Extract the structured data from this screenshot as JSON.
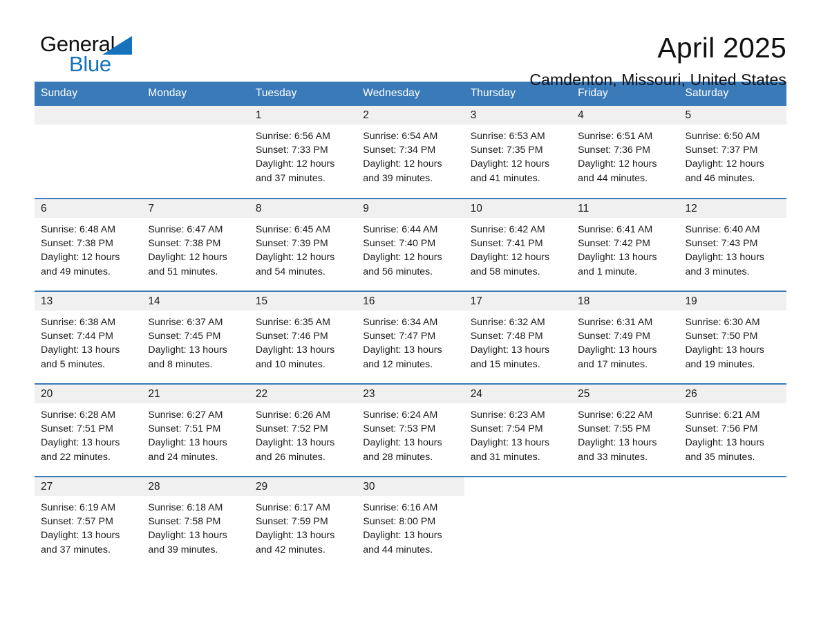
{
  "brand": {
    "word_one": "General",
    "word_two": "Blue",
    "triangle_color": "#1572bb",
    "icon": "triangle-logo-icon"
  },
  "header": {
    "title": "April 2025",
    "subtitle": "Camdenton, Missouri, United States"
  },
  "theme": {
    "header_blue": "#3a7ab8",
    "daynum_band": "#f0f0f0",
    "text": "#1a1a1a"
  },
  "calendar": {
    "weekday_headers": [
      "Sunday",
      "Monday",
      "Tuesday",
      "Wednesday",
      "Thursday",
      "Friday",
      "Saturday"
    ],
    "weeks": [
      [
        {
          "day": "",
          "lines": []
        },
        {
          "day": "",
          "lines": []
        },
        {
          "day": "1",
          "lines": [
            "Sunrise: 6:56 AM",
            "Sunset: 7:33 PM",
            "Daylight: 12 hours",
            "and 37 minutes."
          ]
        },
        {
          "day": "2",
          "lines": [
            "Sunrise: 6:54 AM",
            "Sunset: 7:34 PM",
            "Daylight: 12 hours",
            "and 39 minutes."
          ]
        },
        {
          "day": "3",
          "lines": [
            "Sunrise: 6:53 AM",
            "Sunset: 7:35 PM",
            "Daylight: 12 hours",
            "and 41 minutes."
          ]
        },
        {
          "day": "4",
          "lines": [
            "Sunrise: 6:51 AM",
            "Sunset: 7:36 PM",
            "Daylight: 12 hours",
            "and 44 minutes."
          ]
        },
        {
          "day": "5",
          "lines": [
            "Sunrise: 6:50 AM",
            "Sunset: 7:37 PM",
            "Daylight: 12 hours",
            "and 46 minutes."
          ]
        }
      ],
      [
        {
          "day": "6",
          "lines": [
            "Sunrise: 6:48 AM",
            "Sunset: 7:38 PM",
            "Daylight: 12 hours",
            "and 49 minutes."
          ]
        },
        {
          "day": "7",
          "lines": [
            "Sunrise: 6:47 AM",
            "Sunset: 7:38 PM",
            "Daylight: 12 hours",
            "and 51 minutes."
          ]
        },
        {
          "day": "8",
          "lines": [
            "Sunrise: 6:45 AM",
            "Sunset: 7:39 PM",
            "Daylight: 12 hours",
            "and 54 minutes."
          ]
        },
        {
          "day": "9",
          "lines": [
            "Sunrise: 6:44 AM",
            "Sunset: 7:40 PM",
            "Daylight: 12 hours",
            "and 56 minutes."
          ]
        },
        {
          "day": "10",
          "lines": [
            "Sunrise: 6:42 AM",
            "Sunset: 7:41 PM",
            "Daylight: 12 hours",
            "and 58 minutes."
          ]
        },
        {
          "day": "11",
          "lines": [
            "Sunrise: 6:41 AM",
            "Sunset: 7:42 PM",
            "Daylight: 13 hours",
            "and 1 minute."
          ]
        },
        {
          "day": "12",
          "lines": [
            "Sunrise: 6:40 AM",
            "Sunset: 7:43 PM",
            "Daylight: 13 hours",
            "and 3 minutes."
          ]
        }
      ],
      [
        {
          "day": "13",
          "lines": [
            "Sunrise: 6:38 AM",
            "Sunset: 7:44 PM",
            "Daylight: 13 hours",
            "and 5 minutes."
          ]
        },
        {
          "day": "14",
          "lines": [
            "Sunrise: 6:37 AM",
            "Sunset: 7:45 PM",
            "Daylight: 13 hours",
            "and 8 minutes."
          ]
        },
        {
          "day": "15",
          "lines": [
            "Sunrise: 6:35 AM",
            "Sunset: 7:46 PM",
            "Daylight: 13 hours",
            "and 10 minutes."
          ]
        },
        {
          "day": "16",
          "lines": [
            "Sunrise: 6:34 AM",
            "Sunset: 7:47 PM",
            "Daylight: 13 hours",
            "and 12 minutes."
          ]
        },
        {
          "day": "17",
          "lines": [
            "Sunrise: 6:32 AM",
            "Sunset: 7:48 PM",
            "Daylight: 13 hours",
            "and 15 minutes."
          ]
        },
        {
          "day": "18",
          "lines": [
            "Sunrise: 6:31 AM",
            "Sunset: 7:49 PM",
            "Daylight: 13 hours",
            "and 17 minutes."
          ]
        },
        {
          "day": "19",
          "lines": [
            "Sunrise: 6:30 AM",
            "Sunset: 7:50 PM",
            "Daylight: 13 hours",
            "and 19 minutes."
          ]
        }
      ],
      [
        {
          "day": "20",
          "lines": [
            "Sunrise: 6:28 AM",
            "Sunset: 7:51 PM",
            "Daylight: 13 hours",
            "and 22 minutes."
          ]
        },
        {
          "day": "21",
          "lines": [
            "Sunrise: 6:27 AM",
            "Sunset: 7:51 PM",
            "Daylight: 13 hours",
            "and 24 minutes."
          ]
        },
        {
          "day": "22",
          "lines": [
            "Sunrise: 6:26 AM",
            "Sunset: 7:52 PM",
            "Daylight: 13 hours",
            "and 26 minutes."
          ]
        },
        {
          "day": "23",
          "lines": [
            "Sunrise: 6:24 AM",
            "Sunset: 7:53 PM",
            "Daylight: 13 hours",
            "and 28 minutes."
          ]
        },
        {
          "day": "24",
          "lines": [
            "Sunrise: 6:23 AM",
            "Sunset: 7:54 PM",
            "Daylight: 13 hours",
            "and 31 minutes."
          ]
        },
        {
          "day": "25",
          "lines": [
            "Sunrise: 6:22 AM",
            "Sunset: 7:55 PM",
            "Daylight: 13 hours",
            "and 33 minutes."
          ]
        },
        {
          "day": "26",
          "lines": [
            "Sunrise: 6:21 AM",
            "Sunset: 7:56 PM",
            "Daylight: 13 hours",
            "and 35 minutes."
          ]
        }
      ],
      [
        {
          "day": "27",
          "lines": [
            "Sunrise: 6:19 AM",
            "Sunset: 7:57 PM",
            "Daylight: 13 hours",
            "and 37 minutes."
          ]
        },
        {
          "day": "28",
          "lines": [
            "Sunrise: 6:18 AM",
            "Sunset: 7:58 PM",
            "Daylight: 13 hours",
            "and 39 minutes."
          ]
        },
        {
          "day": "29",
          "lines": [
            "Sunrise: 6:17 AM",
            "Sunset: 7:59 PM",
            "Daylight: 13 hours",
            "and 42 minutes."
          ]
        },
        {
          "day": "30",
          "lines": [
            "Sunrise: 6:16 AM",
            "Sunset: 8:00 PM",
            "Daylight: 13 hours",
            "and 44 minutes."
          ]
        },
        {
          "day": "",
          "lines": []
        },
        {
          "day": "",
          "lines": []
        },
        {
          "day": "",
          "lines": []
        }
      ]
    ]
  }
}
